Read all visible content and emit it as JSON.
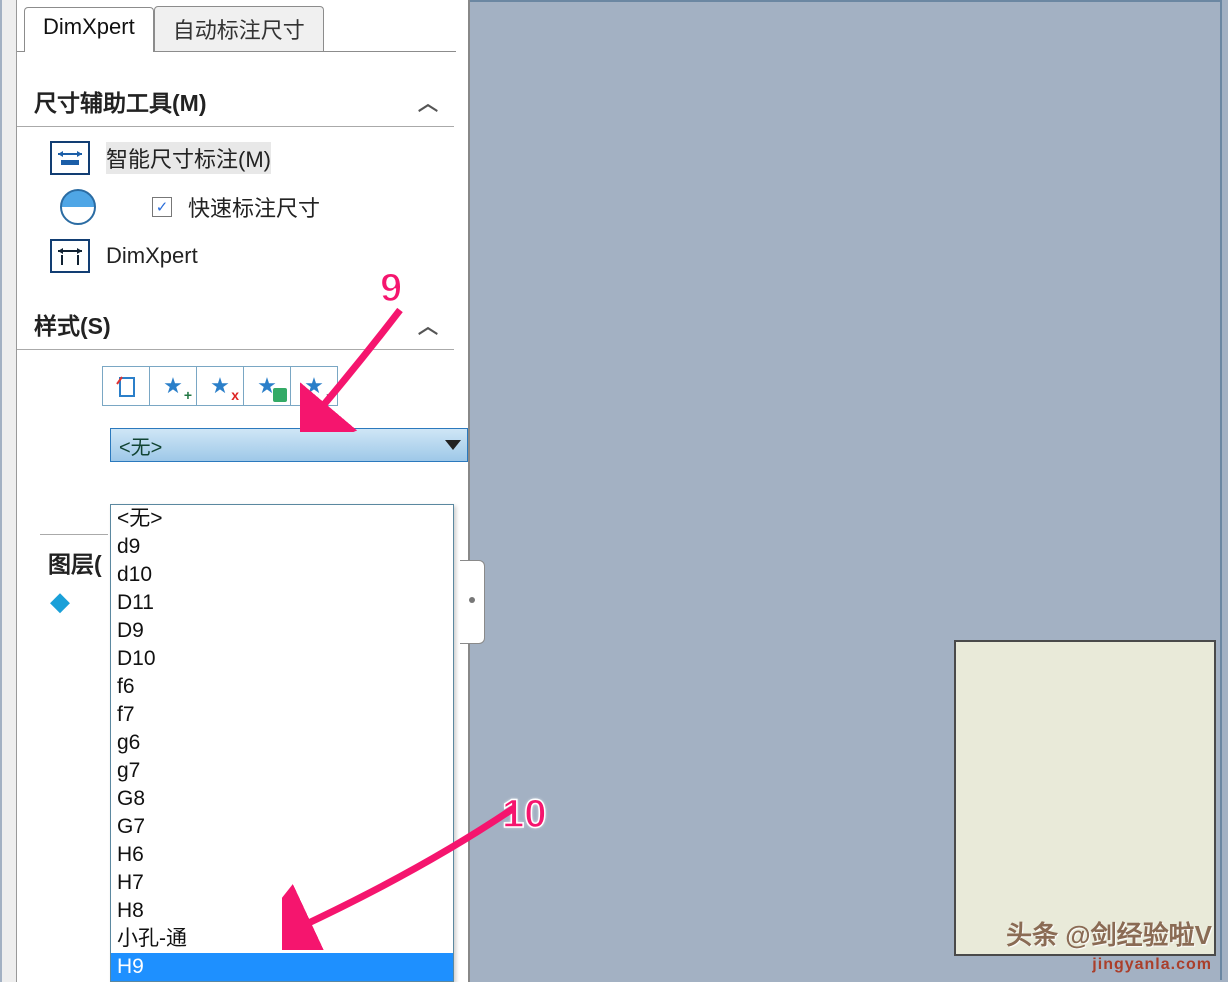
{
  "tabs": {
    "dimxpert": "DimXpert",
    "auto": "自动标注尺寸"
  },
  "section1": {
    "title": "尺寸辅助工具(M)",
    "smart": "智能尺寸标注(M)",
    "quick": "快速标注尺寸",
    "dimx": "DimXpert"
  },
  "section2": {
    "title": "样式(S)",
    "selected": "<无>",
    "options": [
      "<无>",
      "d9",
      "d10",
      "D11",
      "D9",
      "D10",
      "f6",
      "f7",
      "g6",
      "g7",
      "G8",
      "G7",
      "H6",
      "H7",
      "H8",
      "小孔-通",
      "H9"
    ]
  },
  "section3": {
    "title_partial": "图层("
  },
  "callouts": {
    "n9": "9",
    "n10": "10"
  },
  "watermark": {
    "main": "头条 @剑经验啦V",
    "sub": "jingyanla.com"
  }
}
